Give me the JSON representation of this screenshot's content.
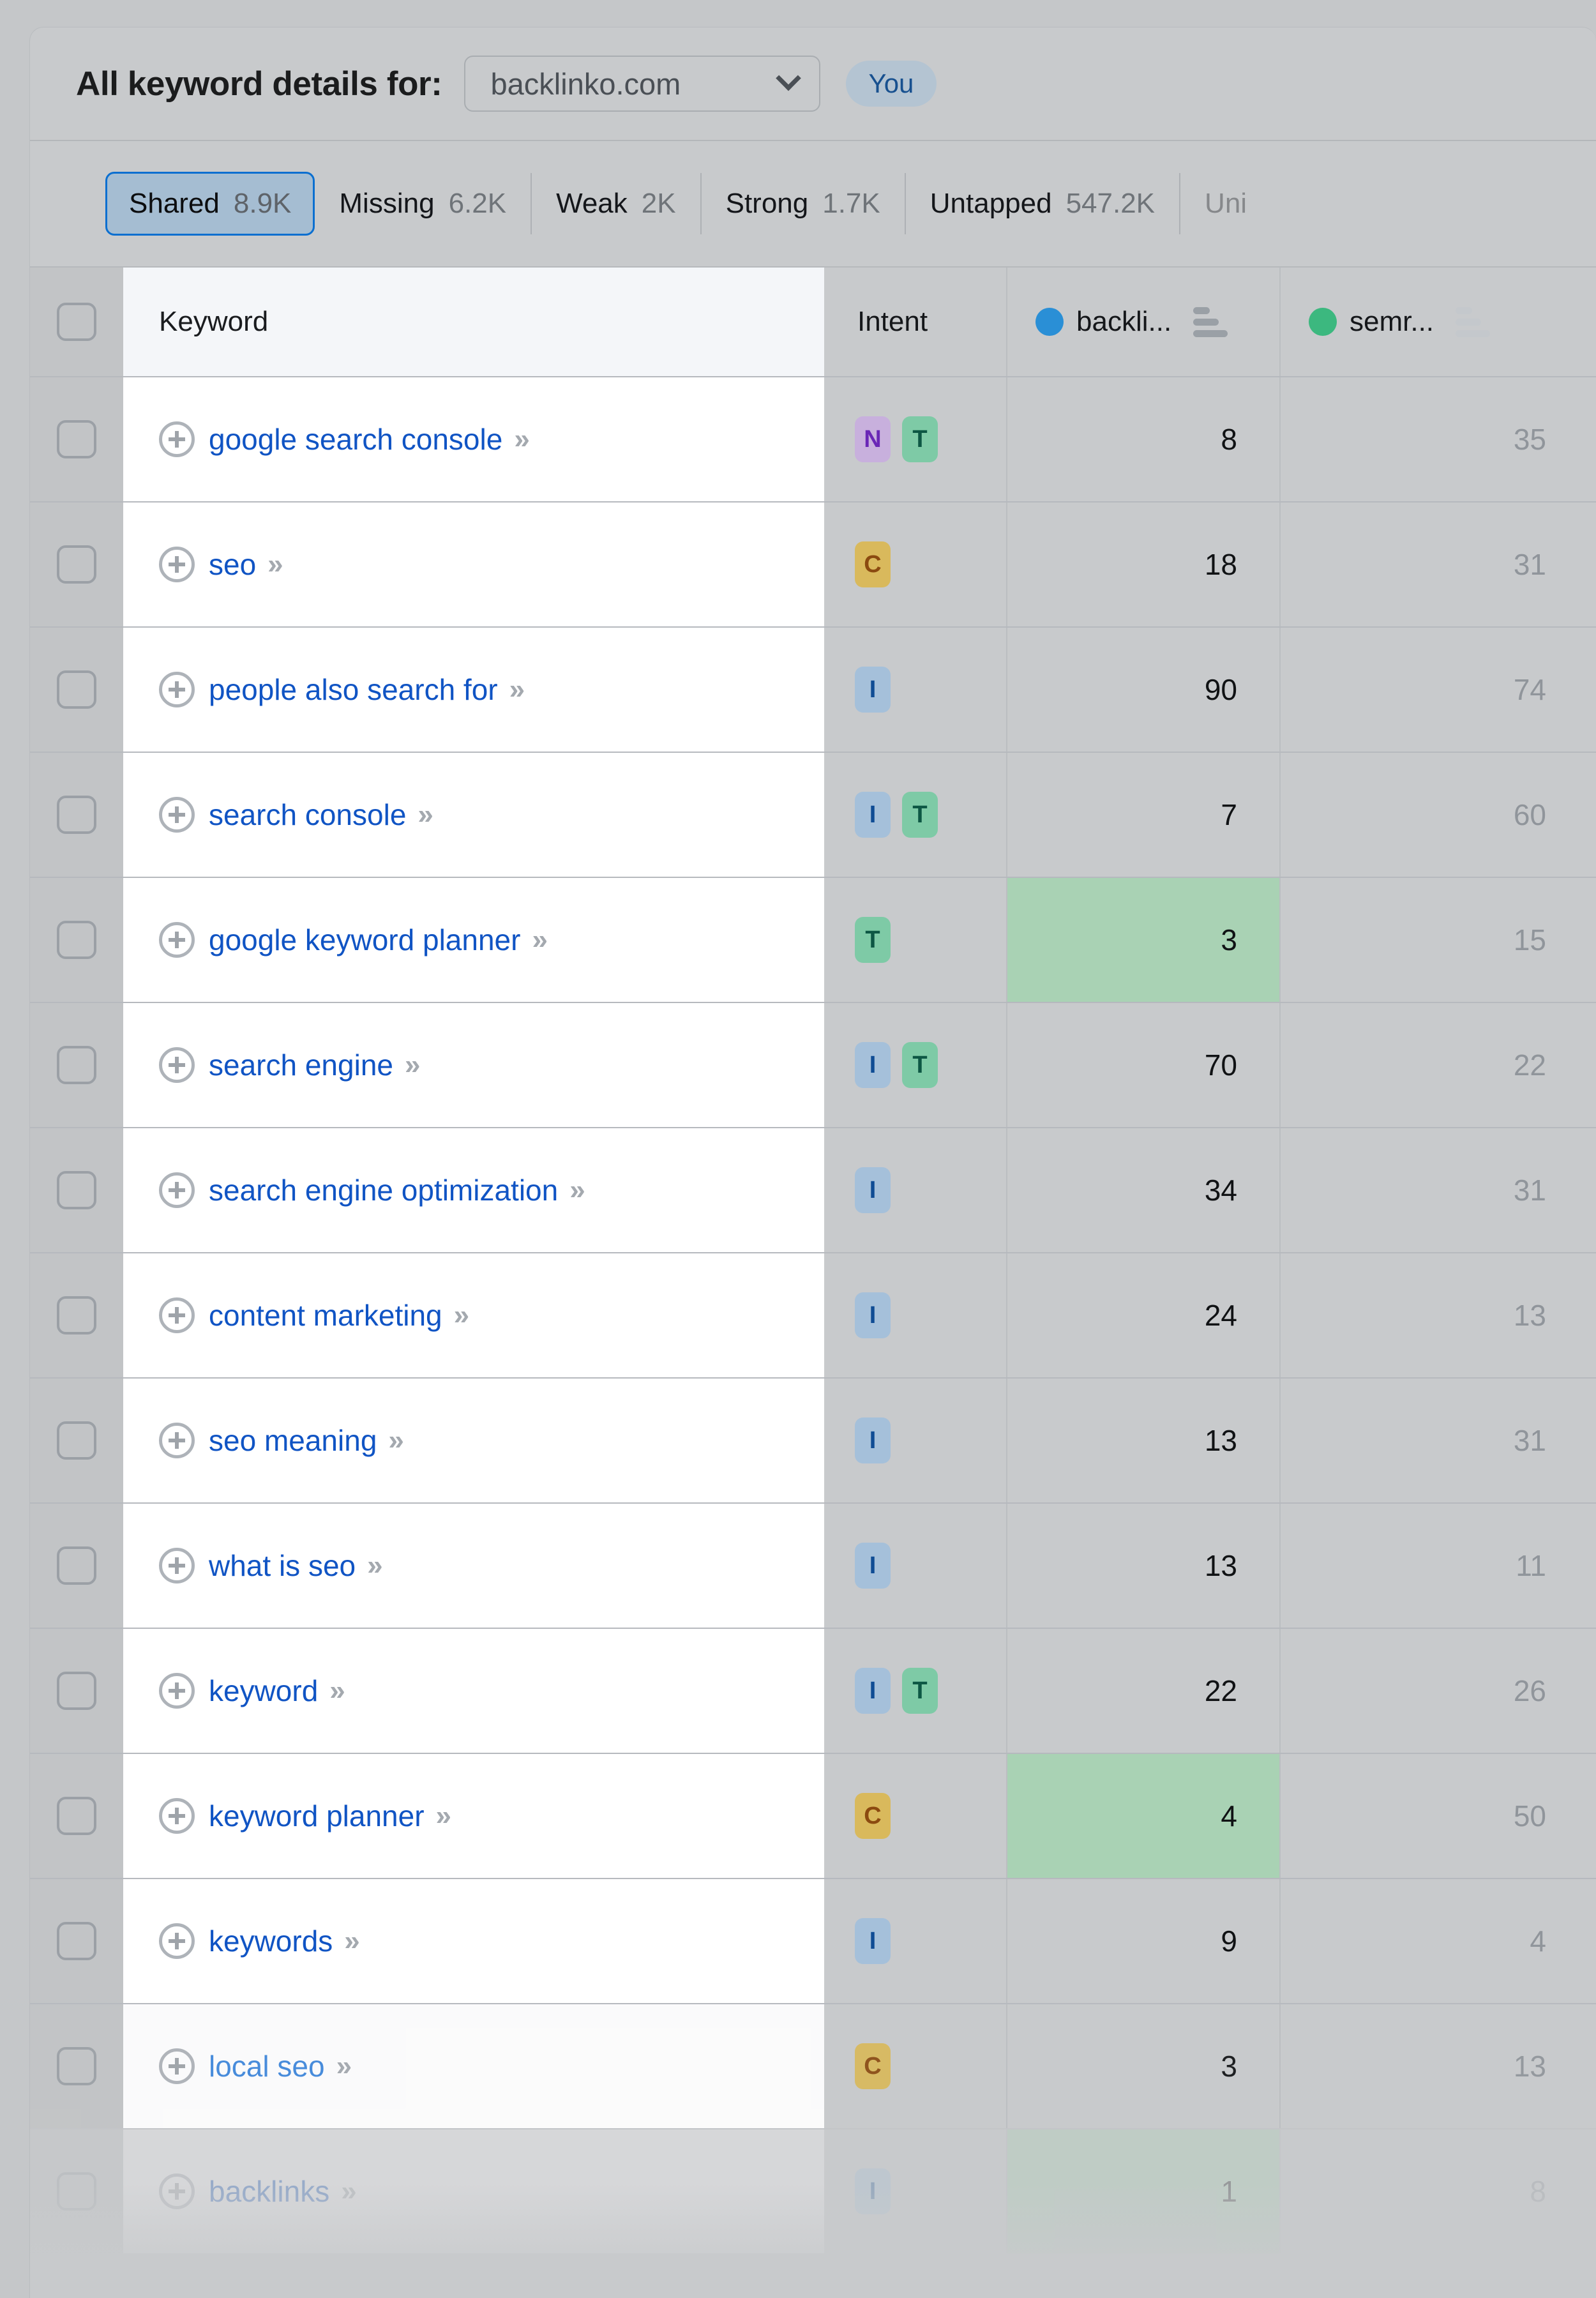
{
  "header": {
    "title": "All keyword details for:",
    "domain_value": "backlinko.com",
    "you_badge": "You"
  },
  "tabs": [
    {
      "label": "Shared",
      "count": "8.9K",
      "active": true,
      "faded": false
    },
    {
      "label": "Missing",
      "count": "6.2K",
      "active": false,
      "faded": false
    },
    {
      "label": "Weak",
      "count": "2K",
      "active": false,
      "faded": false
    },
    {
      "label": "Strong",
      "count": "1.7K",
      "active": false,
      "faded": false
    },
    {
      "label": "Untapped",
      "count": "547.2K",
      "active": false,
      "faded": false
    },
    {
      "label": "Uni",
      "count": "",
      "active": false,
      "faded": true
    }
  ],
  "table": {
    "columns": {
      "keyword": "Keyword",
      "intent": "Intent",
      "site1": "backli...",
      "site2": "semr..."
    },
    "rows": [
      {
        "keyword": "google search console",
        "intents": [
          "N",
          "T"
        ],
        "site1": "8",
        "site2": "35",
        "highlight1": false,
        "fade": "none"
      },
      {
        "keyword": "seo",
        "intents": [
          "C"
        ],
        "site1": "18",
        "site2": "31",
        "highlight1": false,
        "fade": "none"
      },
      {
        "keyword": "people also search for",
        "intents": [
          "I"
        ],
        "site1": "90",
        "site2": "74",
        "highlight1": false,
        "fade": "none"
      },
      {
        "keyword": "search console",
        "intents": [
          "I",
          "T"
        ],
        "site1": "7",
        "site2": "60",
        "highlight1": false,
        "fade": "none"
      },
      {
        "keyword": "google keyword planner",
        "intents": [
          "T"
        ],
        "site1": "3",
        "site2": "15",
        "highlight1": true,
        "fade": "none"
      },
      {
        "keyword": "search engine",
        "intents": [
          "I",
          "T"
        ],
        "site1": "70",
        "site2": "22",
        "highlight1": false,
        "fade": "none"
      },
      {
        "keyword": "search engine optimization",
        "intents": [
          "I"
        ],
        "site1": "34",
        "site2": "31",
        "highlight1": false,
        "fade": "none"
      },
      {
        "keyword": "content marketing",
        "intents": [
          "I"
        ],
        "site1": "24",
        "site2": "13",
        "highlight1": false,
        "fade": "none"
      },
      {
        "keyword": "seo meaning",
        "intents": [
          "I"
        ],
        "site1": "13",
        "site2": "31",
        "highlight1": false,
        "fade": "none"
      },
      {
        "keyword": "what is seo",
        "intents": [
          "I"
        ],
        "site1": "13",
        "site2": "11",
        "highlight1": false,
        "fade": "none"
      },
      {
        "keyword": "keyword",
        "intents": [
          "I",
          "T"
        ],
        "site1": "22",
        "site2": "26",
        "highlight1": false,
        "fade": "none"
      },
      {
        "keyword": "keyword planner",
        "intents": [
          "C"
        ],
        "site1": "4",
        "site2": "50",
        "highlight1": true,
        "fade": "none"
      },
      {
        "keyword": "keywords",
        "intents": [
          "I"
        ],
        "site1": "9",
        "site2": "4",
        "highlight1": false,
        "fade": "none"
      },
      {
        "keyword": "local seo",
        "intents": [
          "C"
        ],
        "site1": "3",
        "site2": "13",
        "highlight1": false,
        "fade": "f1"
      },
      {
        "keyword": "backlinks",
        "intents": [
          "I"
        ],
        "site1": "1",
        "site2": "8",
        "highlight1": true,
        "fade": "f2"
      }
    ]
  },
  "colors": {
    "accent_blue": "#0b6fd0",
    "link_blue": "#1054c4",
    "highlight_green": "#a9d2b4",
    "site1_dot": "#2a8fd6",
    "site2_dot": "#3cb87f",
    "badge_N": "#c8b0dd",
    "badge_T": "#7ecaa6",
    "badge_C": "#d9b95c",
    "badge_I": "#a5c0da"
  }
}
